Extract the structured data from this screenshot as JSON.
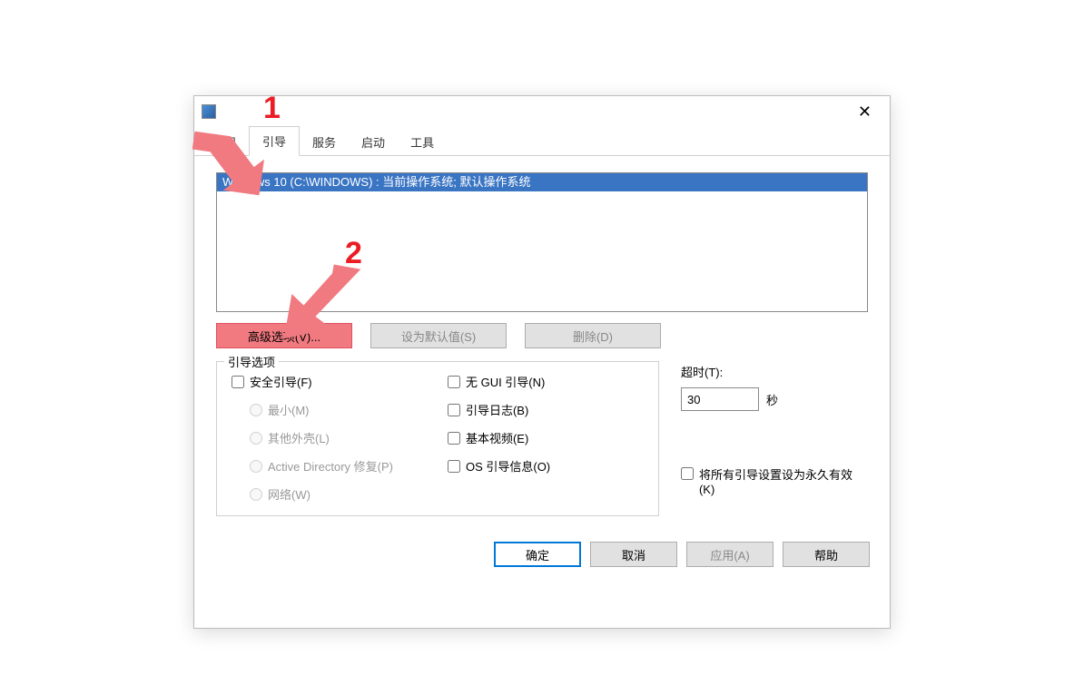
{
  "tabs": {
    "general": "常规",
    "boot": "引导",
    "services": "服务",
    "startup": "启动",
    "tools": "工具"
  },
  "os_list": {
    "item0": "Windows 10 (C:\\WINDOWS) : 当前操作系统; 默认操作系统"
  },
  "mid_buttons": {
    "advanced": "高级选项(V)...",
    "set_default": "设为默认值(S)",
    "delete": "删除(D)"
  },
  "boot_options": {
    "legend": "引导选项",
    "safe_boot": "安全引导(F)",
    "minimal": "最小(M)",
    "alt_shell": "其他外壳(L)",
    "ad_repair": "Active Directory 修复(P)",
    "network": "网络(W)",
    "no_gui": "无 GUI 引导(N)",
    "boot_log": "引导日志(B)",
    "base_video": "基本视频(E)",
    "os_boot_info": "OS 引导信息(O)"
  },
  "timeout": {
    "label": "超时(T):",
    "value": "30",
    "unit": "秒"
  },
  "permanent": "将所有引导设置设为永久有效(K)",
  "dialog_buttons": {
    "ok": "确定",
    "cancel": "取消",
    "apply": "应用(A)",
    "help": "帮助"
  },
  "annotations": {
    "num1": "1",
    "num2": "2"
  }
}
